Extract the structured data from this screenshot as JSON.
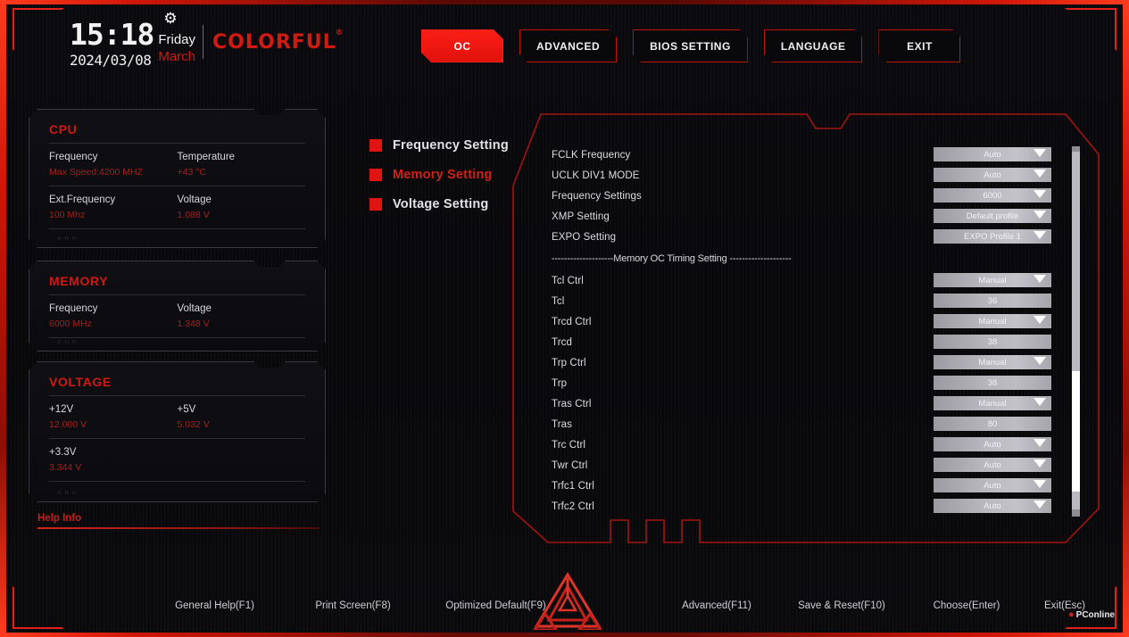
{
  "header": {
    "time": "15:18",
    "date": "2024/03/08",
    "day": "Friday",
    "month": "March",
    "gear_icon": "gear-icon",
    "brand": "COLORFUL",
    "brand_mark": "®",
    "tabs": [
      {
        "label": "OC",
        "active": true
      },
      {
        "label": "ADVANCED",
        "active": false
      },
      {
        "label": "BIOS SETTING",
        "active": false
      },
      {
        "label": "LANGUAGE",
        "active": false
      },
      {
        "label": "EXIT",
        "active": false
      }
    ]
  },
  "info_panels": [
    {
      "title": "CPU",
      "rows": [
        [
          {
            "label": "Frequency",
            "value": "Max Speed:4200 MHZ"
          },
          {
            "label": "Temperature",
            "value": "+43 °C"
          }
        ],
        [
          {
            "label": "Ext.Frequency",
            "value": "100 Mhz"
          },
          {
            "label": "Voltage",
            "value": "1.088 V"
          }
        ]
      ]
    },
    {
      "title": "MEMORY",
      "rows": [
        [
          {
            "label": "Frequency",
            "value": "6000 MHz"
          },
          {
            "label": "Voltage",
            "value": "1.348 V"
          }
        ]
      ]
    },
    {
      "title": "VOLTAGE",
      "rows": [
        [
          {
            "label": "+12V",
            "value": "12.000 V"
          },
          {
            "label": "+5V",
            "value": "5.032 V"
          }
        ],
        [
          {
            "label": "+3.3V",
            "value": "3.344 V"
          },
          {
            "label": "",
            "value": ""
          }
        ]
      ]
    }
  ],
  "help_info": {
    "label": "Help Info"
  },
  "center_menu": [
    {
      "label": "Frequency Setting",
      "selected": false
    },
    {
      "label": "Memory Setting",
      "selected": true
    },
    {
      "label": "Voltage Setting",
      "selected": false
    }
  ],
  "settings": [
    {
      "type": "row",
      "label": "FCLK Frequency",
      "value": "Auto",
      "control": "dropdown"
    },
    {
      "type": "row",
      "label": "UCLK DIV1 MODE",
      "value": "Auto",
      "control": "dropdown"
    },
    {
      "type": "row",
      "label": "Frequency Settings",
      "value": "6000",
      "control": "dropdown"
    },
    {
      "type": "row",
      "label": "XMP Setting",
      "value": "Default profile",
      "control": "dropdown"
    },
    {
      "type": "row",
      "label": "EXPO Setting",
      "value": "EXPO Profile 1",
      "control": "dropdown"
    },
    {
      "type": "separator",
      "label": "--------------------Memory OC Timing Setting --------------------"
    },
    {
      "type": "row",
      "label": "Tcl Ctrl",
      "value": "Manual",
      "control": "dropdown"
    },
    {
      "type": "row",
      "label": "Tcl",
      "value": "36",
      "control": "field"
    },
    {
      "type": "row",
      "label": "Trcd Ctrl",
      "value": "Manual",
      "control": "dropdown"
    },
    {
      "type": "row",
      "label": "Trcd",
      "value": "38",
      "control": "field"
    },
    {
      "type": "row",
      "label": "Trp Ctrl",
      "value": "Manual",
      "control": "dropdown"
    },
    {
      "type": "row",
      "label": "Trp",
      "value": "38",
      "control": "field"
    },
    {
      "type": "row",
      "label": "Tras Ctrl",
      "value": "Manual",
      "control": "dropdown"
    },
    {
      "type": "row",
      "label": "Tras",
      "value": "80",
      "control": "field"
    },
    {
      "type": "row",
      "label": "Trc Ctrl",
      "value": "Auto",
      "control": "dropdown"
    },
    {
      "type": "row",
      "label": "Twr Ctrl",
      "value": "Auto",
      "control": "dropdown"
    },
    {
      "type": "row",
      "label": "Trfc1 Ctrl",
      "value": "Auto",
      "control": "dropdown"
    },
    {
      "type": "row",
      "label": "Trfc2 Ctrl",
      "value": "Auto",
      "control": "dropdown"
    }
  ],
  "footer": {
    "keys": [
      "General Help(F1)",
      "Print Screen(F8)",
      "Optimized Default(F9)",
      "Advanced(F11)",
      "Save & Reset(F10)",
      "Choose(Enter)",
      "Exit(Esc)"
    ],
    "watermark": "PConline",
    "emblem_icon": "triangle-emblem-icon"
  },
  "colors": {
    "accent_red": "#d0201a",
    "bright_red": "#fa1f17",
    "value_red": "#a3201c",
    "panel_bg": "#101014",
    "text": "#dcdce2"
  }
}
